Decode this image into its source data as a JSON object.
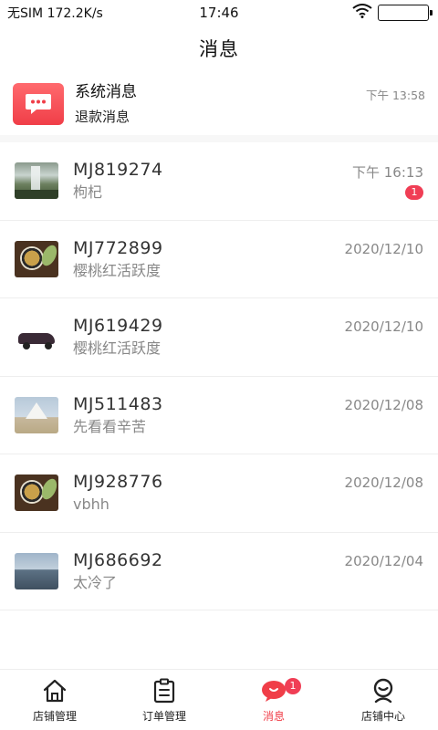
{
  "status_bar": {
    "carrier": "无SIM",
    "speed": "172.2K/s",
    "time": "17:46",
    "icons": [
      "wifi-icon",
      "battery-icon"
    ]
  },
  "title": "消息",
  "system_message": {
    "title": "系统消息",
    "subtitle": "退款消息",
    "time": "下午 13:58",
    "icon": "chat-bubble-icon",
    "color": "#f03e48"
  },
  "conversations": [
    {
      "name": "MJ819274",
      "preview": "枸杞",
      "date": "下午 16:13",
      "unread": "1",
      "thumbnail": "waterfall-photo"
    },
    {
      "name": "MJ772899",
      "preview": "樱桃红活跃度",
      "date": "2020/12/10",
      "unread": "",
      "thumbnail": "tea-photo"
    },
    {
      "name": "MJ619429",
      "preview": "樱桃红活跃度",
      "date": "2020/12/10",
      "unread": "",
      "thumbnail": "car-photo"
    },
    {
      "name": "MJ511483",
      "preview": "先看看辛苦",
      "date": "2020/12/08",
      "unread": "",
      "thumbnail": "tent-photo"
    },
    {
      "name": "MJ928776",
      "preview": "vbhh",
      "date": "2020/12/08",
      "unread": "",
      "thumbnail": "tea-photo"
    },
    {
      "name": "MJ686692",
      "preview": "太冷了",
      "date": "2020/12/04",
      "unread": "",
      "thumbnail": "sea-photo"
    }
  ],
  "tabs": [
    {
      "label": "店铺管理",
      "icon": "home-icon",
      "active": false
    },
    {
      "label": "订单管理",
      "icon": "order-icon",
      "active": false
    },
    {
      "label": "消息",
      "icon": "message-icon",
      "active": true,
      "badge": "1"
    },
    {
      "label": "店铺中心",
      "icon": "profile-icon",
      "active": false
    }
  ],
  "colors": {
    "accent": "#f03e48",
    "badge": "#f03e55",
    "secondary_text": "#888888"
  }
}
